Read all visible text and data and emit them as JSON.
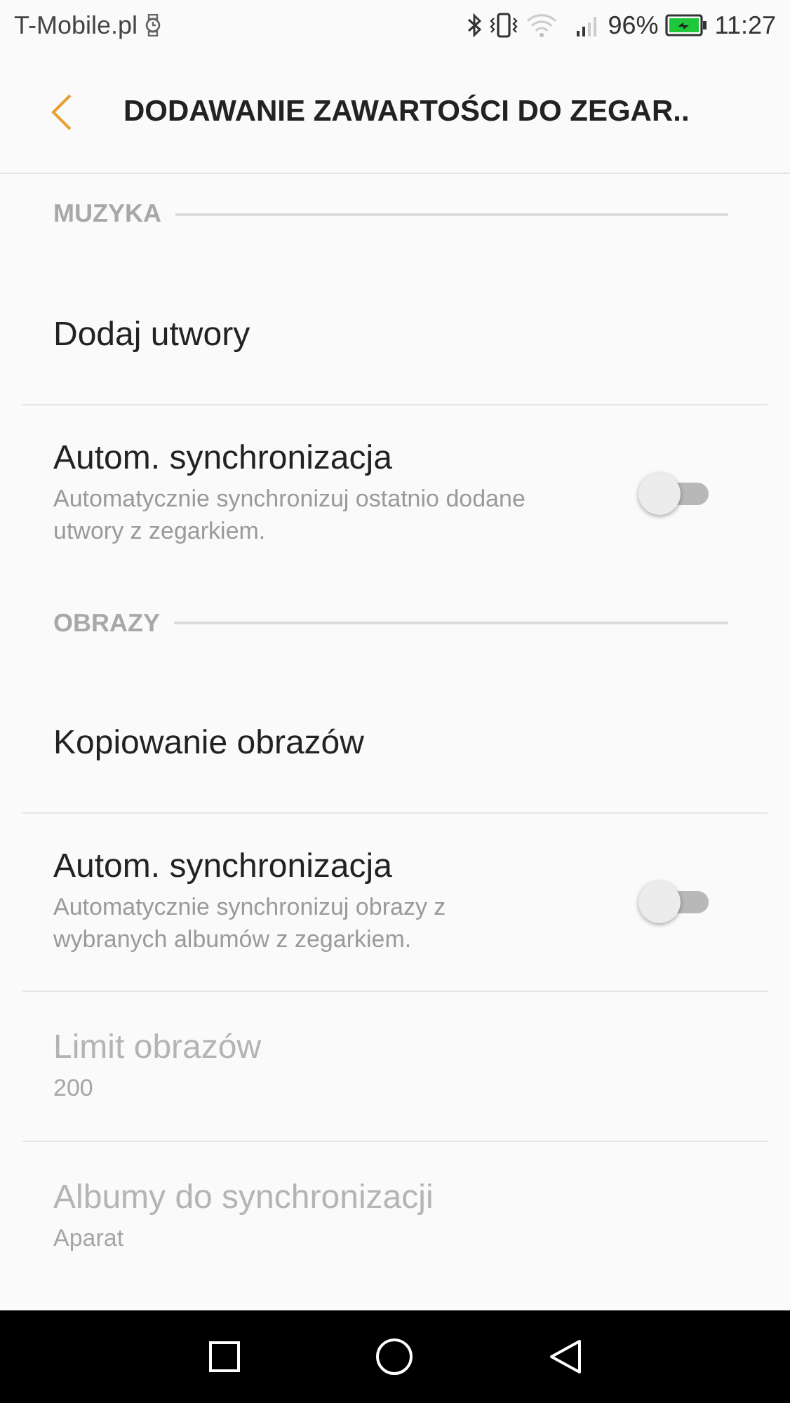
{
  "status_bar": {
    "carrier": "T-Mobile.pl",
    "battery": "96%",
    "time": "11:27"
  },
  "app_bar": {
    "title": "DODAWANIE ZAWARTOŚCI DO ZEGAR.."
  },
  "sections": [
    {
      "title": "MUZYKA",
      "items": [
        {
          "kind": "link",
          "label": "Dodaj utwory",
          "disabled": false
        },
        {
          "kind": "switch",
          "label": "Autom. synchronizacja",
          "summary": "Automatycznie synchronizuj ostatnio dodane utwory z zegarkiem.",
          "on": false,
          "disabled": false
        }
      ]
    },
    {
      "title": "OBRAZY",
      "items": [
        {
          "kind": "link",
          "label": "Kopiowanie obrazów",
          "disabled": false
        },
        {
          "kind": "switch",
          "label": "Autom. synchronizacja",
          "summary": "Automatycznie synchronizuj obrazy z wybranych albumów z zegarkiem.",
          "on": false,
          "disabled": false
        },
        {
          "kind": "value",
          "label": "Limit obrazów",
          "summary": "200",
          "disabled": true
        },
        {
          "kind": "value",
          "label": "Albumy do synchronizacji",
          "summary": "Aparat",
          "disabled": true
        }
      ]
    }
  ]
}
